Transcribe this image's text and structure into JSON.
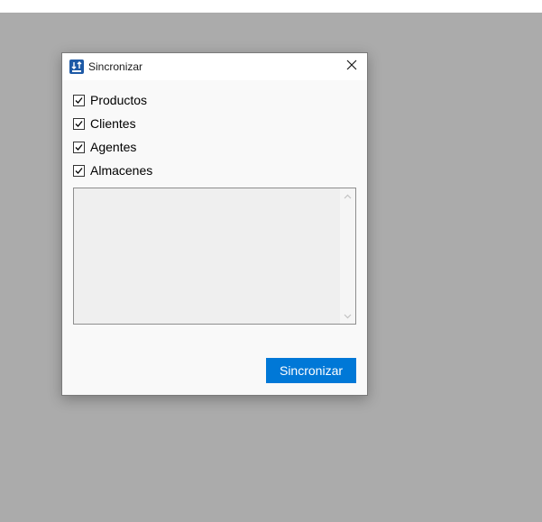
{
  "window": {
    "title": "Sincronizar",
    "icon": "sync-app-icon",
    "close_icon": "close-icon"
  },
  "options": [
    {
      "label": "Productos",
      "checked": true
    },
    {
      "label": "Clientes",
      "checked": true
    },
    {
      "label": "Agentes",
      "checked": true
    },
    {
      "label": "Almacenes",
      "checked": true
    }
  ],
  "log": {
    "text": ""
  },
  "actions": {
    "sync_label": "Sincronizar"
  },
  "colors": {
    "accent": "#0078d7",
    "backdrop": "#ababab"
  }
}
